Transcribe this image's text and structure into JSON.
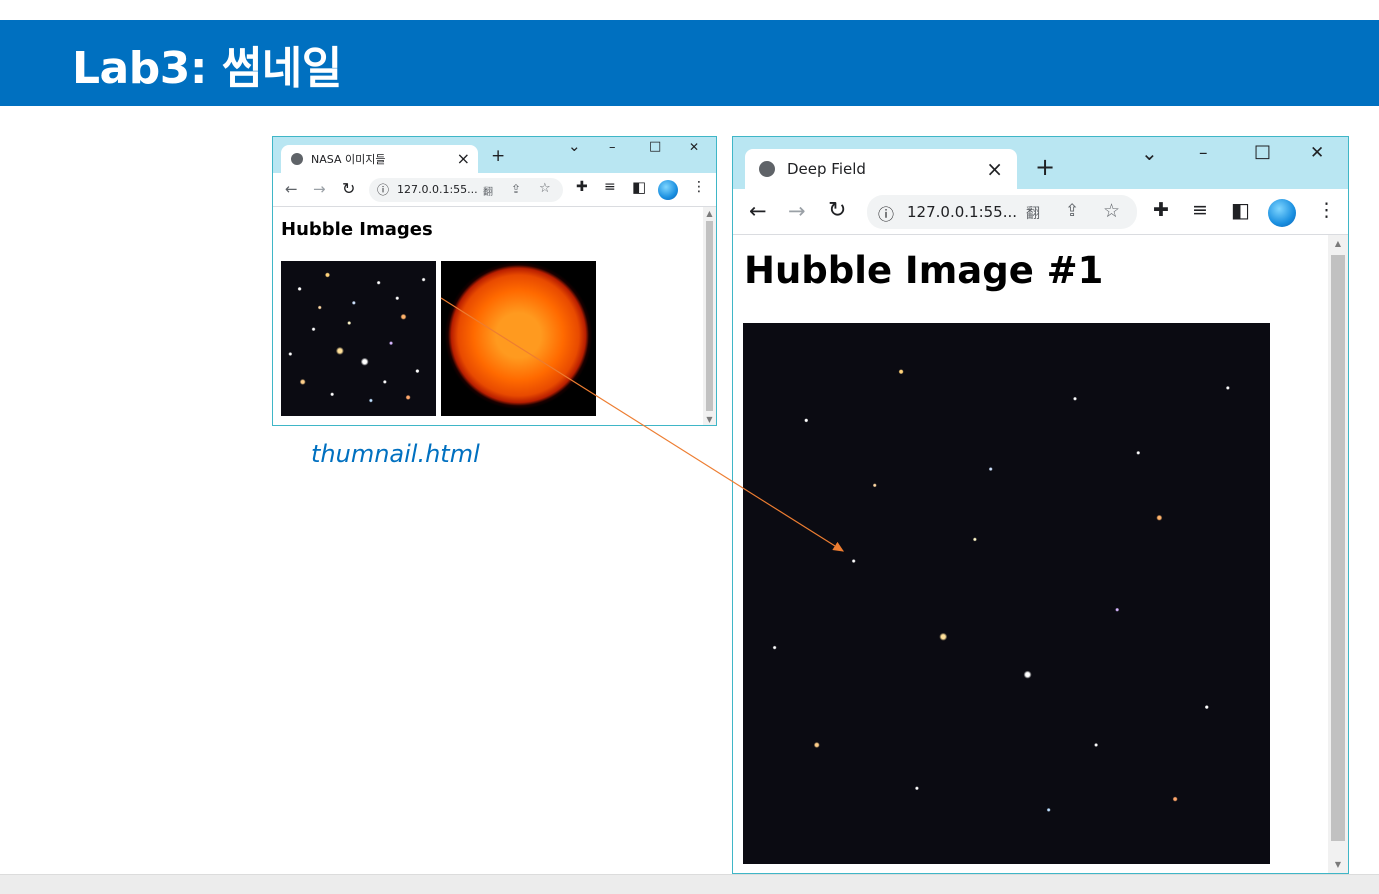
{
  "slide": {
    "title": "Lab3: 썸네일",
    "caption": "thumnail.html"
  },
  "thumbnail_browser": {
    "tab_title": "NASA 이미지들",
    "tab_close": "×",
    "new_tab": "+",
    "address": "127.0.0.1:55...",
    "page_heading": "Hubble Images",
    "images": [
      "Hubble Deep Field thumbnail",
      "Sun thumbnail"
    ]
  },
  "detail_browser": {
    "tab_title": "Deep Field",
    "tab_close": "×",
    "new_tab": "+",
    "address": "127.0.0.1:55...",
    "page_heading": "Hubble Image #1",
    "image": "Hubble Deep Field"
  },
  "icons": {
    "globe": "globe-icon",
    "back": "←",
    "forward": "→",
    "reload": "↻",
    "info": "ⓘ",
    "translate": "翻",
    "share": "⇪",
    "star": "☆",
    "extensions": "✚",
    "media": "≡",
    "sidepanel": "◧",
    "menu": "⋮",
    "chevron": "⌄",
    "minimize": "–",
    "maximize": "□",
    "close": "✕"
  },
  "colors": {
    "title_bar": "#0070c0",
    "tabstrip": "#b9e6f2",
    "caption": "#0070c0",
    "arrow": "#ed7d31"
  }
}
